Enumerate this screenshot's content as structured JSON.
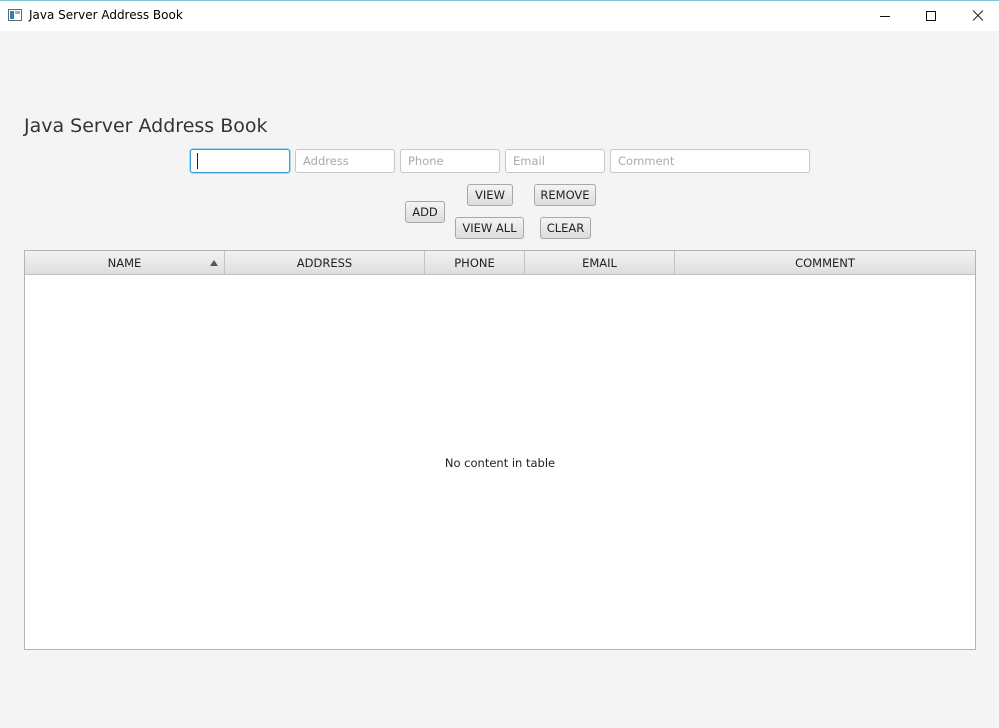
{
  "window": {
    "title": "Java Server Address Book"
  },
  "heading": "Java Server Address Book",
  "form": {
    "name_value": "",
    "address_placeholder": "Address",
    "phone_placeholder": "Phone",
    "email_placeholder": "Email",
    "comment_placeholder": "Comment"
  },
  "buttons": {
    "add": "ADD",
    "view": "VIEW",
    "view_all": "VIEW ALL",
    "remove": "REMOVE",
    "clear": "CLEAR"
  },
  "table": {
    "columns": [
      "NAME",
      "ADDRESS",
      "PHONE",
      "EMAIL",
      "COMMENT"
    ],
    "sorted_column": "NAME",
    "sort_direction": "ascending",
    "rows": [],
    "empty_message": "No content in table"
  },
  "colors": {
    "focus_accent": "#3a9fd8",
    "window_border": "#7fc7d4"
  },
  "icons": {
    "app": "app-window-icon",
    "minimize": "minimize-icon",
    "maximize": "maximize-icon",
    "close": "close-icon",
    "sort": "sort-ascending-icon"
  }
}
